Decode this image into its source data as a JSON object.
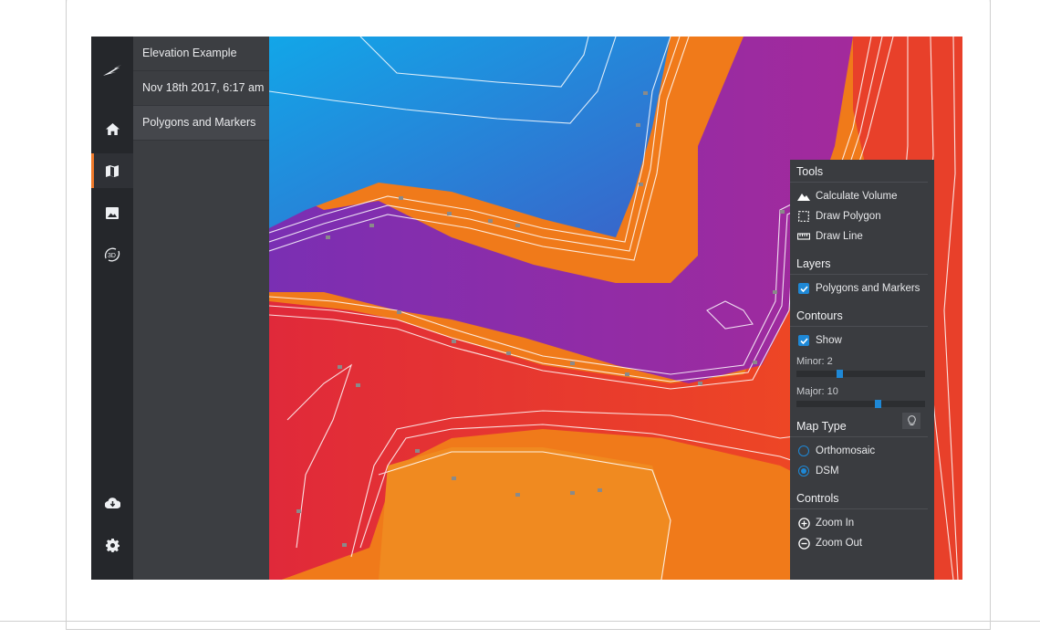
{
  "sidebar": {
    "items": [
      {
        "icon": "home-icon"
      },
      {
        "icon": "map-icon",
        "active": true
      },
      {
        "icon": "image-icon"
      },
      {
        "icon": "3d-view-icon",
        "label": "3D"
      }
    ],
    "bottom": [
      {
        "icon": "cloud-download-icon"
      },
      {
        "icon": "gear-icon"
      }
    ]
  },
  "panel": {
    "project_title": "Elevation Example",
    "date": "Nov 18th 2017, 6:17 am",
    "layer": "Polygons and Markers"
  },
  "tools_panel": {
    "tools_title": "Tools",
    "tools": [
      {
        "label": "Calculate Volume",
        "icon": "mountain-icon"
      },
      {
        "label": "Draw Polygon",
        "icon": "polygon-icon"
      },
      {
        "label": "Draw Line",
        "icon": "ruler-icon"
      }
    ],
    "layers_title": "Layers",
    "layers": [
      {
        "label": "Polygons and Markers",
        "checked": true
      }
    ],
    "contours_title": "Contours",
    "contours_show_label": "Show",
    "contours_show": true,
    "minor_label": "Minor: 2",
    "minor_value": 2,
    "major_label": "Major: 10",
    "major_value": 10,
    "map_type_title": "Map Type",
    "map_types": [
      {
        "label": "Orthomosaic",
        "selected": false
      },
      {
        "label": "DSM",
        "selected": true
      }
    ],
    "controls_title": "Controls",
    "controls": [
      {
        "label": "Zoom In",
        "icon": "zoom-in-icon"
      },
      {
        "label": "Zoom Out",
        "icon": "zoom-out-icon"
      }
    ]
  },
  "colors": {
    "accent": "#1e88d6",
    "active_marker": "#f07a2a",
    "elevation_low": "#1a9be0",
    "elevation_mid": "#8a2fb0",
    "elevation_high": "#e8322a",
    "elevation_base": "#f07a1a"
  }
}
